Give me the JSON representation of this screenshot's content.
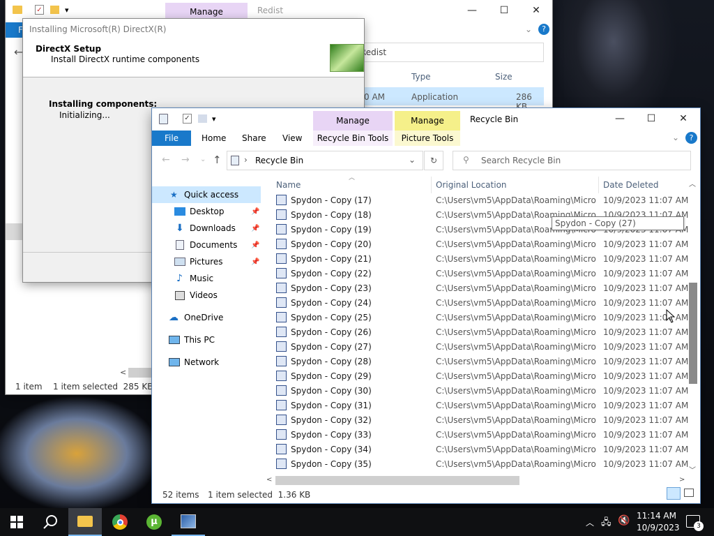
{
  "back_explorer": {
    "qat_arrow": "▾",
    "manage_tab": "Manage",
    "title": "Redist",
    "address": "Redist",
    "col_type": "Type",
    "col_size": "Size",
    "row_time": "0 AM",
    "row_type": "Application",
    "row_size": "286 KB",
    "status_items": "1 item",
    "status_selected": "1 item selected  285 KB",
    "file_tab": "F"
  },
  "directx": {
    "title": "Installing Microsoft(R) DirectX(R)",
    "heading": "DirectX Setup",
    "subheading": "Install DirectX runtime components",
    "installing": "Installing components:",
    "status": "Initializing..."
  },
  "recycle": {
    "title": "Recycle Bin",
    "manage1": "Manage",
    "manage2": "Manage",
    "tabs": {
      "file": "File",
      "home": "Home",
      "share": "Share",
      "view": "View",
      "recycle_tools": "Recycle Bin Tools",
      "picture_tools": "Picture Tools"
    },
    "address": "Recycle Bin",
    "search_placeholder": "Search Recycle Bin",
    "columns": {
      "name": "Name",
      "location": "Original Location",
      "date": "Date Deleted"
    },
    "nav": {
      "quick_access": "Quick access",
      "desktop": "Desktop",
      "downloads": "Downloads",
      "documents": "Documents",
      "pictures": "Pictures",
      "music": "Music",
      "videos": "Videos",
      "onedrive": "OneDrive",
      "thispc": "This PC",
      "network": "Network"
    },
    "rows": [
      {
        "name": "Spydon - Copy (17)",
        "location": "C:\\Users\\vm5\\AppData\\Roaming\\Micros...",
        "date": "10/9/2023 11:07 AM"
      },
      {
        "name": "Spydon - Copy (18)",
        "location": "C:\\Users\\vm5\\AppData\\Roaming\\Micros...",
        "date": "10/9/2023 11:07 AM"
      },
      {
        "name": "Spydon - Copy (19)",
        "location": "C:\\Users\\vm5\\AppData\\Roaming\\Micros...",
        "date": "10/9/2023 11:07 AM"
      },
      {
        "name": "Spydon - Copy (20)",
        "location": "C:\\Users\\vm5\\AppData\\Roaming\\Micros...",
        "date": "10/9/2023 11:07 AM"
      },
      {
        "name": "Spydon - Copy (21)",
        "location": "C:\\Users\\vm5\\AppData\\Roaming\\Micros...",
        "date": "10/9/2023 11:07 AM"
      },
      {
        "name": "Spydon - Copy (22)",
        "location": "C:\\Users\\vm5\\AppData\\Roaming\\Micros...",
        "date": "10/9/2023 11:07 AM"
      },
      {
        "name": "Spydon - Copy (23)",
        "location": "C:\\Users\\vm5\\AppData\\Roaming\\Micros...",
        "date": "10/9/2023 11:07 AM"
      },
      {
        "name": "Spydon - Copy (24)",
        "location": "C:\\Users\\vm5\\AppData\\Roaming\\Micros...",
        "date": "10/9/2023 11:07 AM"
      },
      {
        "name": "Spydon - Copy (25)",
        "location": "C:\\Users\\vm5\\AppData\\Roaming\\Micros...",
        "date": "10/9/2023 11:07 AM"
      },
      {
        "name": "Spydon - Copy (26)",
        "location": "C:\\Users\\vm5\\AppData\\Roaming\\Micros...",
        "date": "10/9/2023 11:07 AM"
      },
      {
        "name": "Spydon - Copy (27)",
        "location": "C:\\Users\\vm5\\AppData\\Roaming\\Micros...",
        "date": "10/9/2023 11:07 AM"
      },
      {
        "name": "Spydon - Copy (28)",
        "location": "C:\\Users\\vm5\\AppData\\Roaming\\Micros...",
        "date": "10/9/2023 11:07 AM"
      },
      {
        "name": "Spydon - Copy (29)",
        "location": "C:\\Users\\vm5\\AppData\\Roaming\\Micros...",
        "date": "10/9/2023 11:07 AM"
      },
      {
        "name": "Spydon - Copy (30)",
        "location": "C:\\Users\\vm5\\AppData\\Roaming\\Micros...",
        "date": "10/9/2023 11:07 AM"
      },
      {
        "name": "Spydon - Copy (31)",
        "location": "C:\\Users\\vm5\\AppData\\Roaming\\Micros...",
        "date": "10/9/2023 11:07 AM"
      },
      {
        "name": "Spydon - Copy (32)",
        "location": "C:\\Users\\vm5\\AppData\\Roaming\\Micros...",
        "date": "10/9/2023 11:07 AM"
      },
      {
        "name": "Spydon - Copy (33)",
        "location": "C:\\Users\\vm5\\AppData\\Roaming\\Micros...",
        "date": "10/9/2023 11:07 AM"
      },
      {
        "name": "Spydon - Copy (34)",
        "location": "C:\\Users\\vm5\\AppData\\Roaming\\Micros...",
        "date": "10/9/2023 11:07 AM"
      },
      {
        "name": "Spydon - Copy (35)",
        "location": "C:\\Users\\vm5\\AppData\\Roaming\\Micros...",
        "date": "10/9/2023 11:07 AM"
      }
    ],
    "tooltip": "Spydon - Copy (27)",
    "status_items": "52 items",
    "status_selected": "1 item selected  1.36 KB"
  },
  "taskbar": {
    "time": "11:14 AM",
    "date": "10/9/2023",
    "notifications": "3"
  },
  "colors": {
    "accent": "#0063b1",
    "manage_purple": "#e8d5f5",
    "manage_yellow": "#f5f08a",
    "selected": "#cce8ff"
  }
}
